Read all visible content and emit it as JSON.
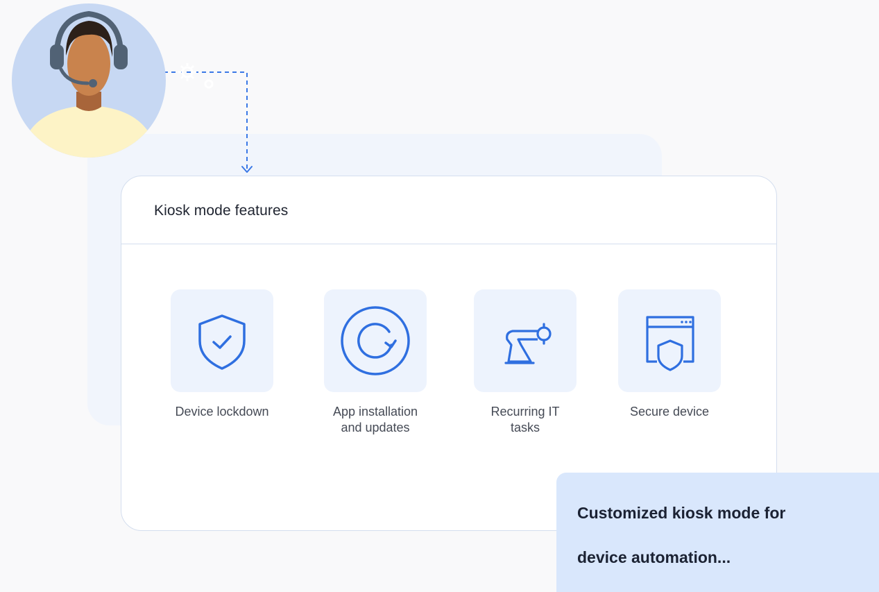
{
  "card": {
    "title": "Kiosk mode features"
  },
  "features": [
    {
      "label_line1": "Device lockdown",
      "label_line2": "",
      "icon": "shield-check-icon"
    },
    {
      "label_line1": "App installation",
      "label_line2": "and updates",
      "icon": "refresh-circle-icon"
    },
    {
      "label_line1": "Recurring IT",
      "label_line2": "tasks",
      "icon": "robotic-arm-icon"
    },
    {
      "label_line1": "Secure device",
      "label_line2": "",
      "icon": "browser-shield-icon"
    }
  ],
  "callout": {
    "line1": "Customized kiosk mode for",
    "line2": "device automation..."
  },
  "colors": {
    "accent": "#2f6fe0",
    "tile": "#edf3fd",
    "callout_bg": "#d9e7fc",
    "avatar_bg": "#c7d8f3",
    "shirt": "#fdf3c6",
    "skin": "#c9834d",
    "hair": "#2c2019",
    "headset": "#516275"
  },
  "avatar": {
    "icon": "support-agent-avatar"
  },
  "connector": {
    "icon": "gear-icon",
    "style": "dashed-arrow"
  }
}
